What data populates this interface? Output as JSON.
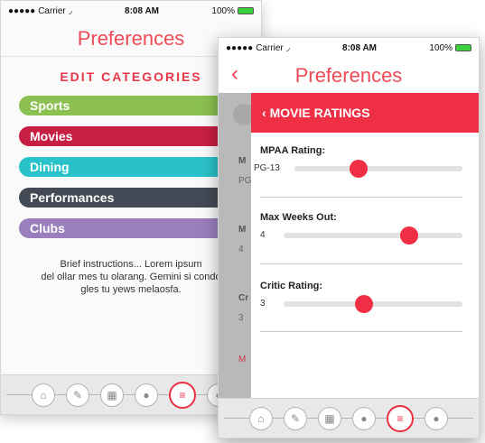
{
  "status": {
    "carrier": "Carrier",
    "time": "8:08 AM",
    "battery": "100%"
  },
  "back_screen": {
    "title": "Preferences",
    "heading": "EDIT CATEGORIES",
    "categories": [
      {
        "label": "Sports",
        "color": "#8cc152"
      },
      {
        "label": "Movies",
        "color": "#c71f43"
      },
      {
        "label": "Dining",
        "color": "#29c2c9"
      },
      {
        "label": "Performances",
        "color": "#444a55"
      },
      {
        "label": "Clubs",
        "color": "#9b7fbc"
      }
    ],
    "instructions": [
      "Brief instructions... Lorem ipsum",
      "del ollar mes tu olarang. Gemini si condo",
      "gles tu yews melaosfa."
    ]
  },
  "front_screen": {
    "title": "Preferences",
    "panel_title": "MOVIE RATINGS",
    "settings": [
      {
        "label": "MPAA Rating:",
        "value": "PG-13",
        "level": 0.38
      },
      {
        "label": "Max Weeks Out:",
        "value": "4",
        "level": 0.7
      },
      {
        "label": "Critic Rating:",
        "value": "3",
        "level": 0.45
      }
    ],
    "underlay": {
      "m1": "M",
      "pg": "PG",
      "m2": "M",
      "four": "4",
      "cr": "Cr",
      "three": "3",
      "m3": "M"
    }
  },
  "tabbar": [
    "home-icon",
    "pencil-icon",
    "calendar-icon",
    "group-icon",
    "sliders-icon",
    "user-icon"
  ],
  "colors": {
    "accent": "#ef3044"
  }
}
